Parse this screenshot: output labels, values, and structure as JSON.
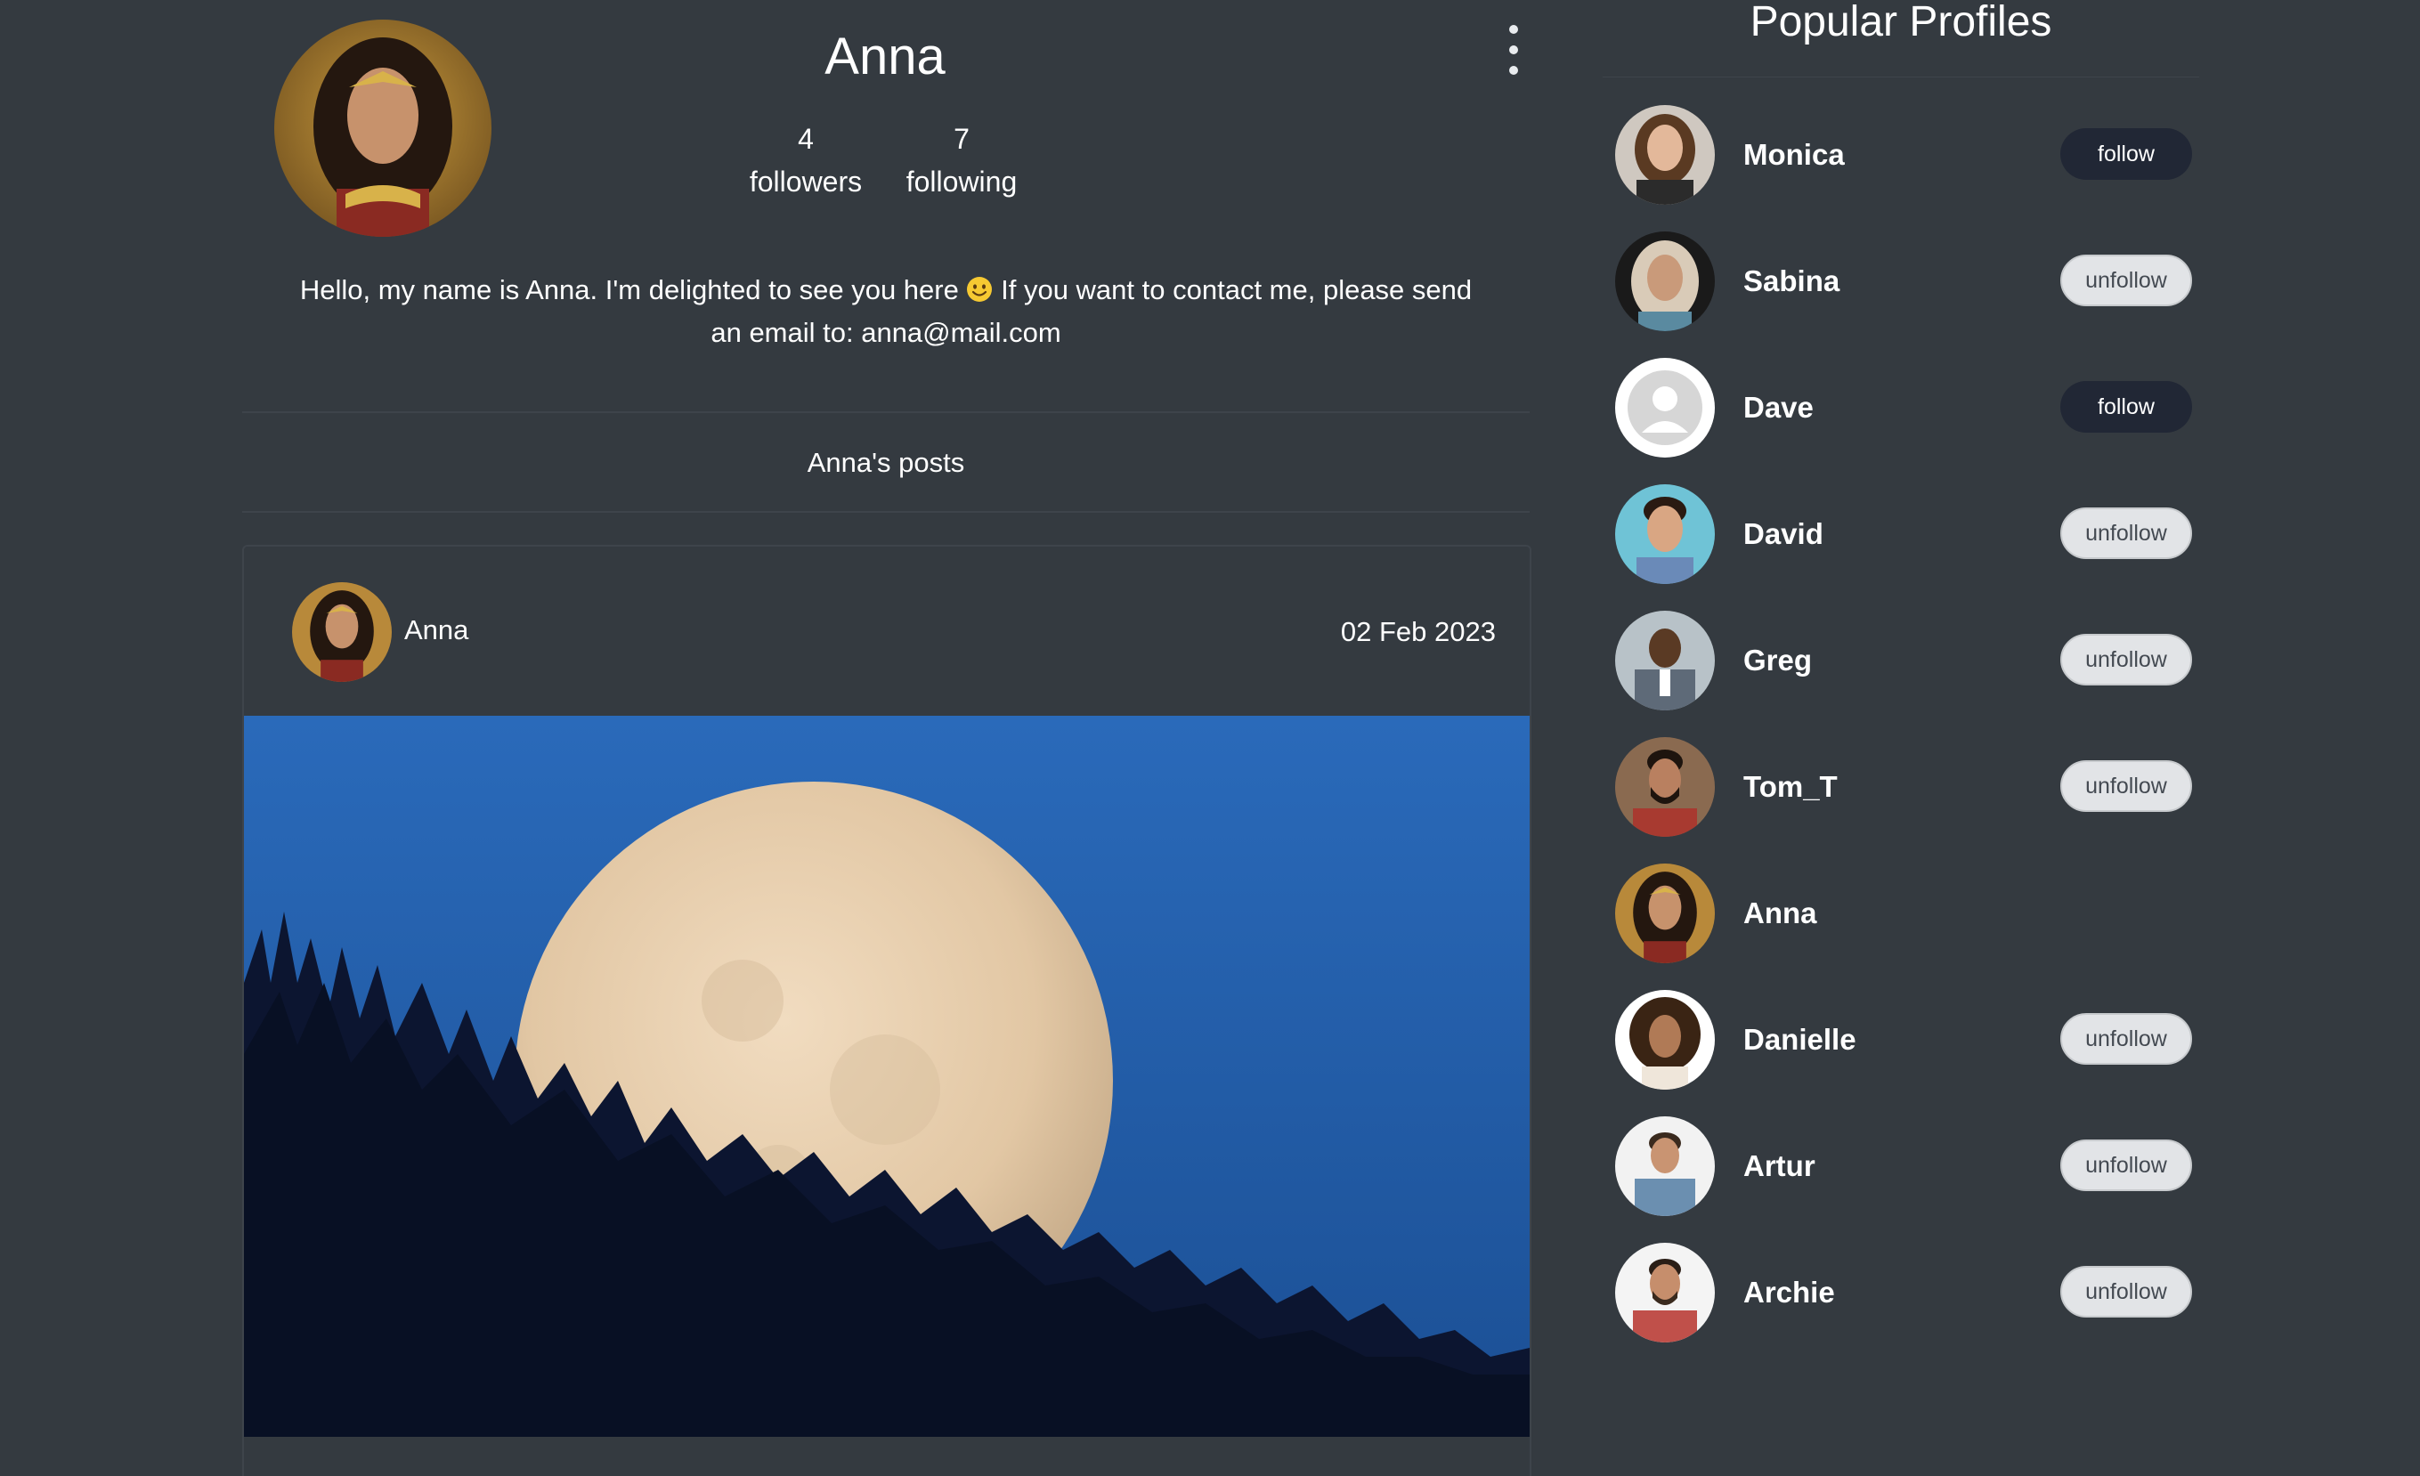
{
  "profile": {
    "name": "Anna",
    "followers_count": "4",
    "followers_label": "followers",
    "following_count": "7",
    "following_label": "following",
    "bio_part1": "Hello, my name is Anna. I'm delighted to see you here",
    "bio_part2": "If you want to contact me, please send an email to: anna@mail.com"
  },
  "posts_heading": "Anna's posts",
  "post": {
    "author": "Anna",
    "date": "02 Feb 2023",
    "image": "moon-over-forest"
  },
  "sidebar": {
    "title": "Popular Profiles",
    "profiles": [
      {
        "name": "Monica",
        "button": "follow"
      },
      {
        "name": "Sabina",
        "button": "unfollow"
      },
      {
        "name": "Dave",
        "button": "follow"
      },
      {
        "name": "David",
        "button": "unfollow"
      },
      {
        "name": "Greg",
        "button": "unfollow"
      },
      {
        "name": "Tom_T",
        "button": "unfollow"
      },
      {
        "name": "Anna",
        "button": ""
      },
      {
        "name": "Danielle",
        "button": "unfollow"
      },
      {
        "name": "Artur",
        "button": "unfollow"
      },
      {
        "name": "Archie",
        "button": "unfollow"
      }
    ]
  },
  "colors": {
    "background": "#343a40",
    "follow_button": "#212735",
    "unfollow_button": "#e2e4e7"
  }
}
